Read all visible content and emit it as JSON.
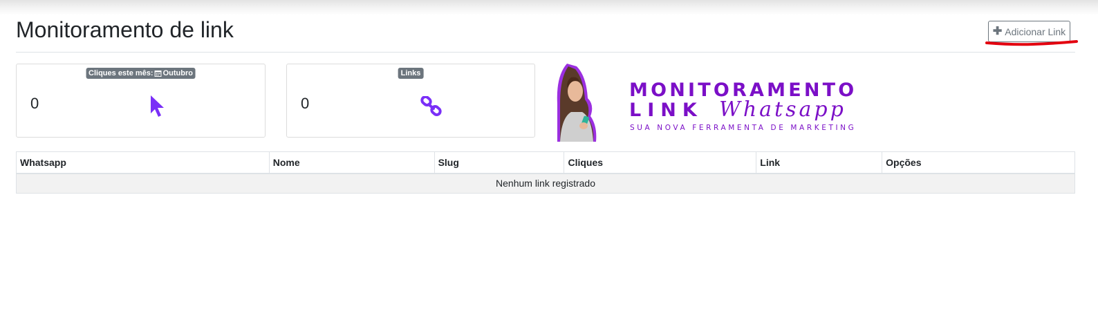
{
  "header": {
    "title": "Monitoramento de link",
    "add_button_label": "Adicionar Link",
    "add_button_icon": "plus-icon",
    "highlight_color": "#e3000f"
  },
  "cards": {
    "clicks": {
      "badge_label": "Cliques este mês:",
      "badge_icon": "calendar-icon",
      "badge_month": "Outubro",
      "value": "0",
      "icon": "cursor-pointer-icon"
    },
    "links": {
      "badge_label": "Links",
      "value": "0",
      "icon": "chain-link-icon"
    }
  },
  "banner": {
    "line1": "MONITORAMENTO",
    "line2_bold": "LINK",
    "line2_script": "Whatsapp",
    "tagline": "SUA NOVA FERRAMENTA DE MARKETING",
    "brand_color": "#7b0fc7"
  },
  "table": {
    "columns": [
      "Whatsapp",
      "Nome",
      "Slug",
      "Cliques",
      "Link",
      "Opções"
    ],
    "empty_message": "Nenhum link registrado"
  },
  "colors": {
    "accent_purple": "#7a2ff7",
    "badge_gray": "#6c757d"
  }
}
